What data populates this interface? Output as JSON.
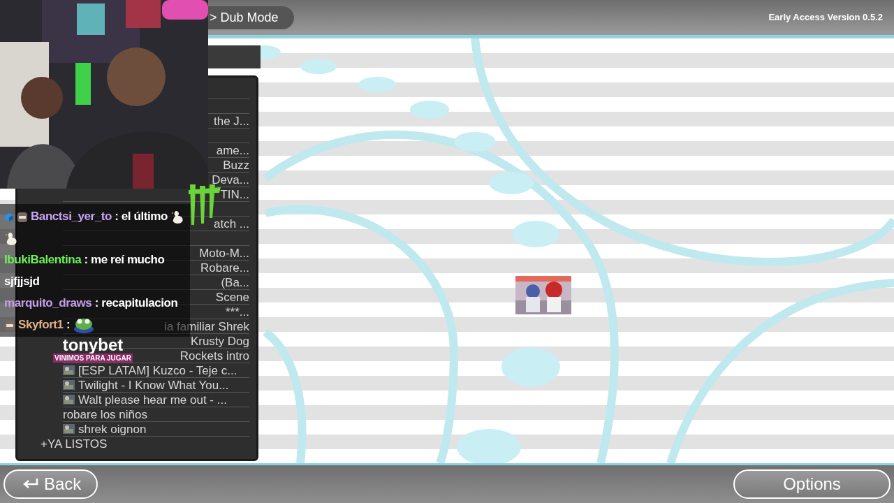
{
  "top_bar": {
    "breadcrumb": "> Dub Mode",
    "version": "Early Access Version 0.5.2"
  },
  "list": {
    "items": [
      {
        "kind": "covered"
      },
      {
        "kind": "covered"
      },
      {
        "kind": "cut",
        "title": "the J..."
      },
      {
        "kind": "covered"
      },
      {
        "kind": "cut",
        "title": "ame..."
      },
      {
        "kind": "cut",
        "title": "Buzz"
      },
      {
        "kind": "cut",
        "title": "Deva..."
      },
      {
        "kind": "cut",
        "title": "TIN..."
      },
      {
        "kind": "covered"
      },
      {
        "kind": "cut",
        "title": "atch ..."
      },
      {
        "kind": "covered"
      },
      {
        "kind": "cut",
        "title": "Moto-M..."
      },
      {
        "kind": "cut",
        "title": "Robare..."
      },
      {
        "kind": "cut",
        "title": "(Ba..."
      },
      {
        "kind": "cut",
        "title": "Scene"
      },
      {
        "kind": "cut",
        "title": "***..."
      },
      {
        "kind": "cut",
        "title": "ia familiar Shrek"
      },
      {
        "kind": "cut",
        "title": "Krusty Dog"
      },
      {
        "kind": "cut",
        "title": "Rockets intro"
      },
      {
        "kind": "full",
        "title": "[ESP LATAM] Kuzco - Teje c...",
        "thumbnail": true
      },
      {
        "kind": "full",
        "title": "Twilight - I Know What You...",
        "thumbnail": true
      },
      {
        "kind": "full",
        "title": "Walt please hear me out - ...",
        "thumbnail": true
      },
      {
        "kind": "full",
        "title": "robare los niños",
        "thumbnail": false
      },
      {
        "kind": "full",
        "title": "shrek oignon",
        "thumbnail": true
      },
      {
        "kind": "add",
        "title": "+YA LISTOS"
      }
    ]
  },
  "chat": {
    "messages": [
      {
        "badges": [
          {
            "kind": "cube"
          },
          {
            "kind": "mask"
          }
        ],
        "user": "Banctsi_yer_to",
        "color": "#c7a5f5",
        "parts": [
          {
            "kind": "text",
            "text": ": el último"
          },
          {
            "kind": "duck"
          },
          {
            "kind": "duck"
          }
        ]
      },
      {
        "user": "IbukiBalentina",
        "color": "#6ef05a",
        "parts": [
          {
            "kind": "text",
            "text": ": me reí mucho sjfjjsjd"
          }
        ]
      },
      {
        "user": "marquito_draws",
        "color": "#c4a0e8",
        "parts": [
          {
            "kind": "text",
            "text": ": recapitulacion"
          }
        ]
      },
      {
        "badges": [
          {
            "kind": "mask"
          }
        ],
        "user": "Skyfort1",
        "color": "#e0b088",
        "parts": [
          {
            "kind": "text",
            "text": ":"
          },
          {
            "kind": "frog"
          }
        ]
      }
    ]
  },
  "sponsor": {
    "name": "tonybet",
    "tagline": "VINIMOS PARA JUGAR"
  },
  "buttons": {
    "back": "Back",
    "options": "Options"
  }
}
